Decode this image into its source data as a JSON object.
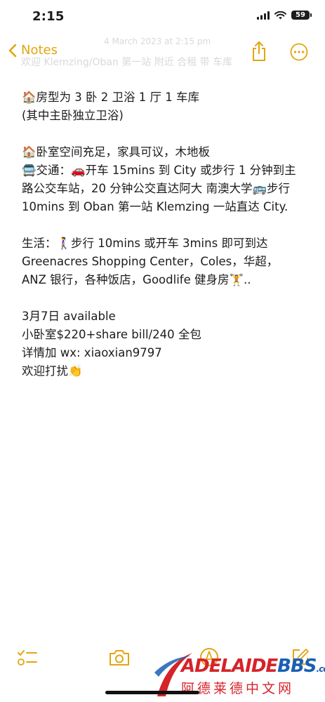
{
  "status_bar": {
    "time": "2:15",
    "battery": "59"
  },
  "nav": {
    "back_label": "Notes",
    "faded_date": "4 March 2023 at 2:15 pm",
    "faded_title": "欢迎 Klemzing/Oban 第一站 附近 合租 带 车库"
  },
  "note": {
    "lines": [
      "🏠房型为 3 卧 2 卫浴 1 厅 1 车库",
      "(其中主卧独立卫浴)",
      "",
      "🏠卧室空间充足，家具可议，木地板",
      "🚍交通：🚗开车 15mins 到 City 或步行 1 分钟到主路公交车站，20 分钟公交直达阿大 南澳大学🚌步行 10mins 到 Oban 第一站 Klemzing 一站直达 City.",
      "",
      "生活：🚶‍♀️步行 10mins 或开车 3mins 即可到达 Greenacres Shopping Center，Coles，华超，ANZ 银行，各种饭店，Goodlife 健身房🏋️..",
      "",
      "3月7日 available",
      "小卧室$220+share bill/240 全包",
      "详情加 wx: xiaoxian9797",
      "欢迎打扰👏"
    ]
  },
  "watermark": {
    "en_part1": "ADELAIDE",
    "en_part2": "BBS",
    "en_part3": ".com",
    "cn": "阿德莱德中文网"
  },
  "colors": {
    "accent": "#e3a50f",
    "text": "#1c1c1e",
    "watermark_red": "#d6232a",
    "watermark_blue": "#1a5fb4"
  },
  "icons": {
    "back": "chevron-left-icon",
    "share": "share-icon",
    "more": "ellipsis-circle-icon",
    "checklist": "checklist-icon",
    "camera": "camera-icon",
    "markup": "pen-tip-icon",
    "compose": "compose-icon"
  }
}
